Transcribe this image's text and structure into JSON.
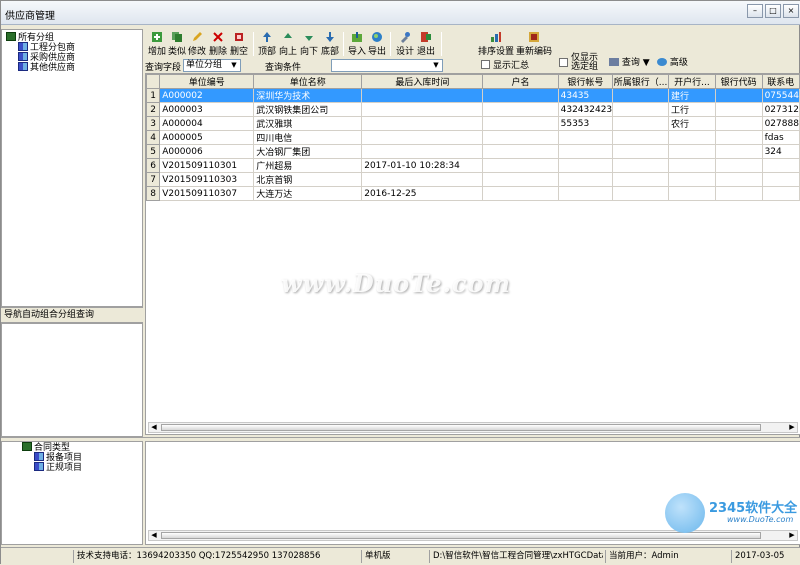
{
  "window": {
    "title": "供应商管理"
  },
  "tree_top": {
    "root": "所有分组",
    "children": [
      "工程分包商",
      "采购供应商",
      "其他供应商"
    ]
  },
  "left_nav_label": "导航自动组合分组查询",
  "tree_bottom": {
    "root": "合同类型",
    "children": [
      "报备项目",
      "正规项目"
    ]
  },
  "toolbar": {
    "add": "增加",
    "similar": "类似",
    "edit": "修改",
    "delete": "删除",
    "clear": "删空",
    "top": "顶部",
    "up": "向上",
    "down": "向下",
    "bottom": "底部",
    "import": "导入",
    "export": "导出",
    "design": "设计",
    "exit": "退出",
    "sort_settings": "排序设置",
    "renumber": "重新编码",
    "show_summary": "显示汇总",
    "only_show": "仅显示",
    "selected_group": "选定组",
    "query": "查询",
    "advanced": "高级"
  },
  "query_row": {
    "field_label": "查询字段",
    "field_value": "单位分组",
    "condition_label": "查询条件",
    "condition_value": ""
  },
  "grid": {
    "columns": [
      "单位编号",
      "单位名称",
      "最后入库时间",
      "户名",
      "银行帐号",
      "所属银行（...",
      "开户行...",
      "银行代码",
      "联系电"
    ],
    "rows": [
      {
        "n": "1",
        "code": "A000002",
        "name": "深圳华为技术",
        "time": "",
        "account_name": "",
        "account": "43435",
        "bank": "",
        "branch": "建行",
        "bank_code": "",
        "phone": "075544"
      },
      {
        "n": "2",
        "code": "A000003",
        "name": "武汉钢铁集团公司",
        "time": "",
        "account_name": "",
        "account": "432432423",
        "bank": "",
        "branch": "工行",
        "bank_code": "",
        "phone": "027312"
      },
      {
        "n": "3",
        "code": "A000004",
        "name": "武汉雅琪",
        "time": "",
        "account_name": "",
        "account": "55353",
        "bank": "",
        "branch": "农行",
        "bank_code": "",
        "phone": "027888"
      },
      {
        "n": "4",
        "code": "A000005",
        "name": "四川电信",
        "time": "",
        "account_name": "",
        "account": "",
        "bank": "",
        "branch": "",
        "bank_code": "",
        "phone": "fdas"
      },
      {
        "n": "5",
        "code": "A000006",
        "name": "大冶钢厂集团",
        "time": "",
        "account_name": "",
        "account": "",
        "bank": "",
        "branch": "",
        "bank_code": "",
        "phone": "324"
      },
      {
        "n": "6",
        "code": "V201509110301",
        "name": "广州超易",
        "time": "2017-01-10 10:28:34",
        "account_name": "",
        "account": "",
        "bank": "",
        "branch": "",
        "bank_code": "",
        "phone": ""
      },
      {
        "n": "7",
        "code": "V201509110303",
        "name": "北京首钢",
        "time": "",
        "account_name": "",
        "account": "",
        "bank": "",
        "branch": "",
        "bank_code": "",
        "phone": ""
      },
      {
        "n": "8",
        "code": "V201509110307",
        "name": "大连万达",
        "time": "2016-12-25",
        "account_name": "",
        "account": "",
        "bank": "",
        "branch": "",
        "bank_code": "",
        "phone": ""
      }
    ]
  },
  "statusbar": {
    "support": "技术支持电话：13694203350 QQ:1725542950 137028856",
    "mode": "单机版",
    "path": "D:\\智信软件\\智信工程合同管理\\zxHTGCData.sys",
    "user": "当前用户：Admin",
    "date": "2017-03-05"
  },
  "watermark": "www.DuoTe.com",
  "logo": {
    "brand": "2345软件大全",
    "url": "www.DuoTe.com"
  },
  "colors": {
    "selection": "#3399ff",
    "chrome": "#ece9d8"
  }
}
